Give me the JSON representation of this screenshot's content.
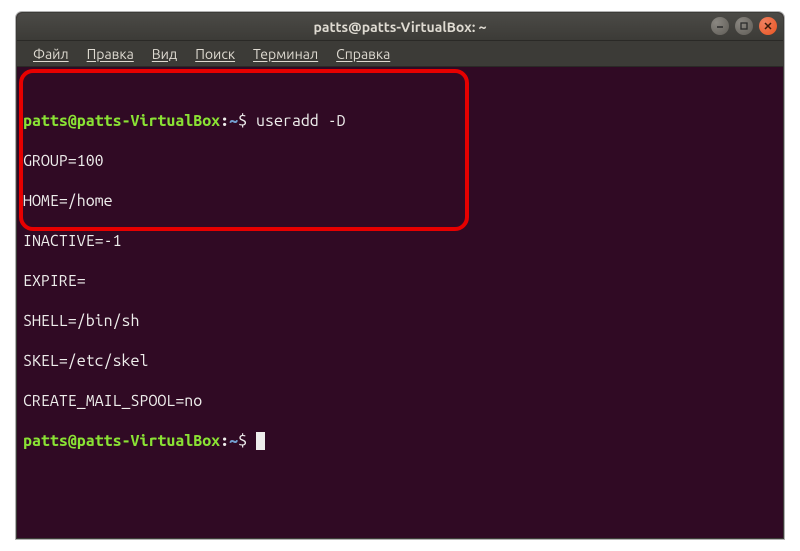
{
  "titlebar": {
    "title": "patts@patts-VirtualBox: ~"
  },
  "menubar": {
    "items": [
      {
        "label": "Файл"
      },
      {
        "label": "Правка"
      },
      {
        "label": "Вид"
      },
      {
        "label": "Поиск"
      },
      {
        "label": "Терминал"
      },
      {
        "label": "Справка"
      }
    ]
  },
  "prompt": {
    "user": "patts",
    "at": "@",
    "host": "patts-VirtualBox",
    "colon": ":",
    "path": "~",
    "symbol": "$"
  },
  "terminal": {
    "command": "useradd -D",
    "output": [
      "GROUP=100",
      "HOME=/home",
      "INACTIVE=-1",
      "EXPIRE=",
      "SHELL=/bin/sh",
      "SKEL=/etc/skel",
      "CREATE_MAIL_SPOOL=no"
    ]
  }
}
